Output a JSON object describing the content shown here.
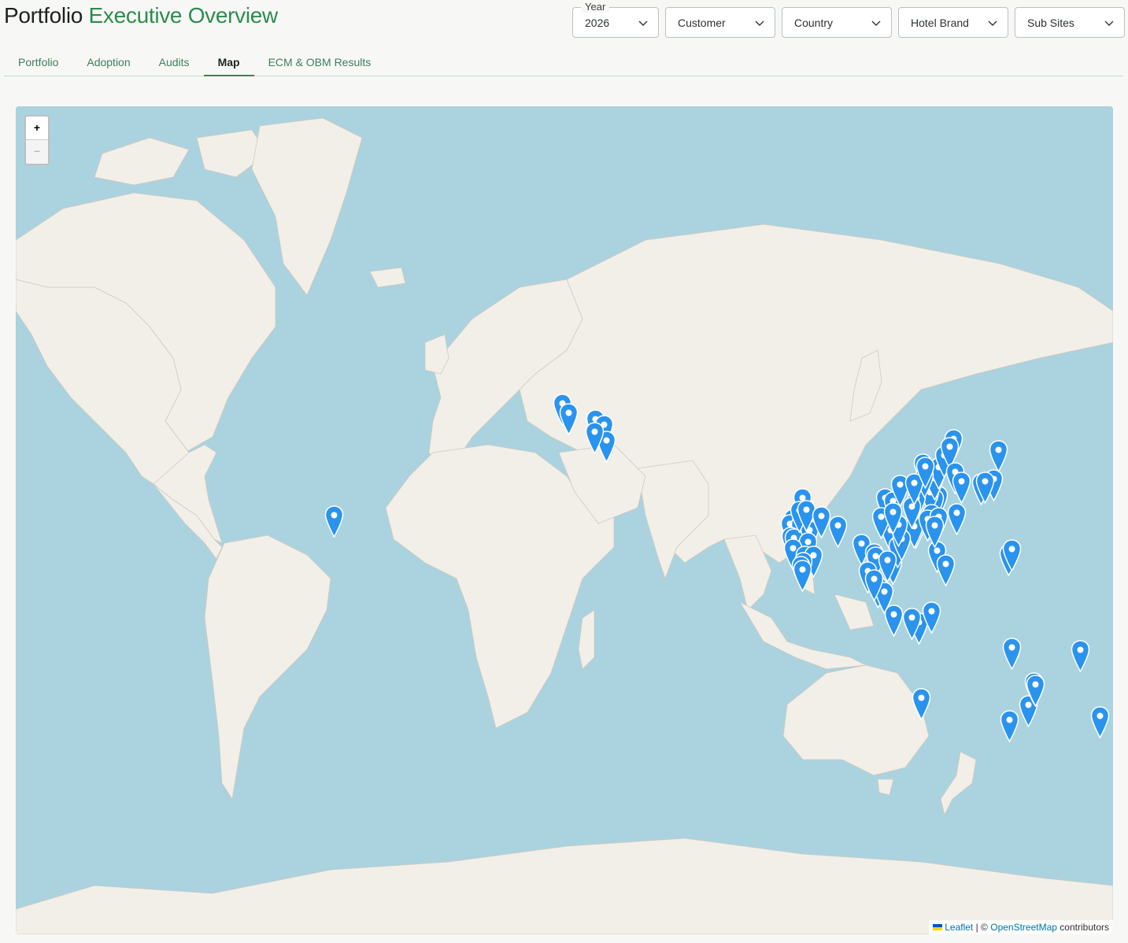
{
  "header": {
    "title_part1": "Portfolio",
    "title_part2": "Executive Overview"
  },
  "filters": {
    "year": {
      "legend": "Year",
      "value": "2026"
    },
    "customer": {
      "placeholder": "Customer"
    },
    "country": {
      "placeholder": "Country"
    },
    "hotel_brand": {
      "placeholder": "Hotel Brand"
    },
    "sub_sites": {
      "placeholder": "Sub Sites"
    }
  },
  "tabs": [
    {
      "label": "Portfolio"
    },
    {
      "label": "Adoption"
    },
    {
      "label": "Audits"
    },
    {
      "label": "Map",
      "active": true
    },
    {
      "label": "ECM & OBM Results"
    }
  ],
  "map": {
    "zoom_in": "+",
    "zoom_out": "−",
    "attribution": {
      "leaflet": "Leaflet",
      "separator": "| ©",
      "osm": "OpenStreetMap",
      "suffix": "contributors"
    },
    "colors": {
      "water": "#aad3df",
      "land": "#f2efe9",
      "marker": "#2a93ee",
      "accent": "#2e8b4e"
    },
    "marker_locations": [
      [
        53.4,
        -2.2
      ],
      [
        51.5,
        -0.1
      ],
      [
        50.1,
        8.7
      ],
      [
        48.9,
        11.6
      ],
      [
        45.5,
        12.3
      ],
      [
        47.4,
        8.5
      ],
      [
        25.5,
        -77.3
      ],
      [
        28.6,
        77.2
      ],
      [
        30.7,
        76.8
      ],
      [
        24.6,
        73.7
      ],
      [
        23.0,
        72.6
      ],
      [
        22.7,
        75.9
      ],
      [
        21.1,
        79.1
      ],
      [
        19.1,
        72.9
      ],
      [
        18.5,
        73.9
      ],
      [
        17.4,
        78.5
      ],
      [
        15.5,
        73.8
      ],
      [
        13.0,
        77.6
      ],
      [
        13.1,
        80.3
      ],
      [
        11.0,
        77.0
      ],
      [
        9.9,
        76.3
      ],
      [
        8.5,
        76.9
      ],
      [
        22.6,
        88.4
      ],
      [
        26.9,
        75.8
      ],
      [
        27.2,
        78.0
      ],
      [
        25.3,
        83.0
      ],
      [
        16.8,
        96.2
      ],
      [
        13.8,
        100.5
      ],
      [
        12.9,
        100.9
      ],
      [
        7.9,
        98.3
      ],
      [
        3.1,
        101.7
      ],
      [
        1.35,
        103.8
      ],
      [
        5.4,
        100.3
      ],
      [
        10.8,
        106.7
      ],
      [
        21.0,
        105.8
      ],
      [
        16.1,
        108.2
      ],
      [
        11.6,
        104.9
      ],
      [
        14.6,
        121.0
      ],
      [
        10.3,
        123.9
      ],
      [
        -6.2,
        106.8
      ],
      [
        -8.7,
        115.2
      ],
      [
        -7.3,
        112.7
      ],
      [
        -5.1,
        119.4
      ],
      [
        39.9,
        116.4
      ],
      [
        31.2,
        121.5
      ],
      [
        30.3,
        120.2
      ],
      [
        32.1,
        118.8
      ],
      [
        23.1,
        113.3
      ],
      [
        22.5,
        114.1
      ],
      [
        22.3,
        114.2
      ],
      [
        22.2,
        113.5
      ],
      [
        30.6,
        104.1
      ],
      [
        29.6,
        106.5
      ],
      [
        34.3,
        108.9
      ],
      [
        30.6,
        114.3
      ],
      [
        28.2,
        112.9
      ],
      [
        25.0,
        102.7
      ],
      [
        26.1,
        119.3
      ],
      [
        24.5,
        118.1
      ],
      [
        36.1,
        120.4
      ],
      [
        38.9,
        121.6
      ],
      [
        41.8,
        123.4
      ],
      [
        45.8,
        126.6
      ],
      [
        25.0,
        121.5
      ],
      [
        22.6,
        120.3
      ],
      [
        18.3,
        109.5
      ],
      [
        22.8,
        108.3
      ],
      [
        26.6,
        106.7
      ],
      [
        36.7,
        117.0
      ],
      [
        34.7,
        113.6
      ],
      [
        39.1,
        117.2
      ],
      [
        43.9,
        125.3
      ],
      [
        37.6,
        127.0
      ],
      [
        35.2,
        129.1
      ],
      [
        35.7,
        139.7
      ],
      [
        34.7,
        135.5
      ],
      [
        35.2,
        136.9
      ],
      [
        43.1,
        141.4
      ],
      [
        26.2,
        127.7
      ],
      [
        13.5,
        144.8
      ],
      [
        15.2,
        145.7
      ],
      [
        -31.9,
        115.9
      ],
      [
        -33.9,
        151.2
      ],
      [
        -37.8,
        145.0
      ],
      [
        -27.5,
        153.0
      ],
      [
        -28.0,
        153.4
      ],
      [
        -16.9,
        145.8
      ],
      [
        -36.8,
        174.8
      ],
      [
        -17.7,
        168.3
      ]
    ]
  }
}
